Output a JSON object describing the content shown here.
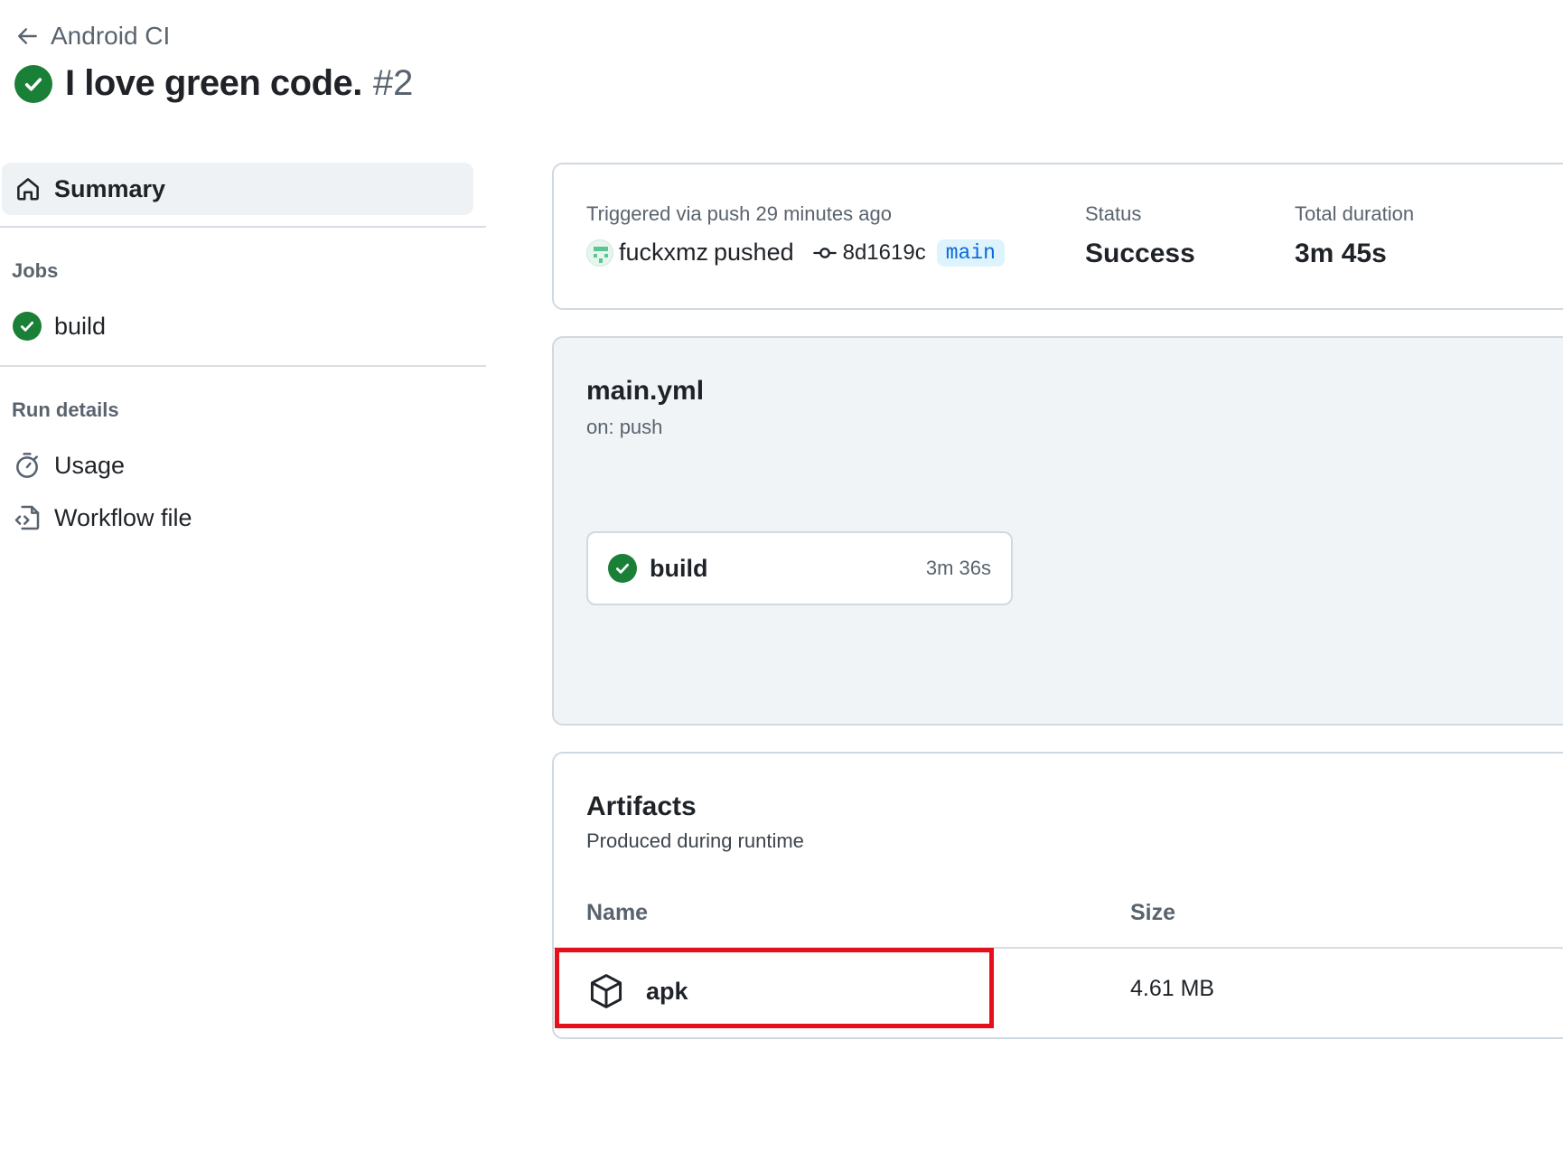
{
  "header": {
    "back_label": "Android CI",
    "run_title": "I love green code.",
    "run_number": "#2"
  },
  "sidebar": {
    "summary_label": "Summary",
    "jobs_heading": "Jobs",
    "jobs": [
      {
        "name": "build",
        "status": "success"
      }
    ],
    "run_details_heading": "Run details",
    "details": [
      {
        "label": "Usage",
        "icon": "stopwatch-icon"
      },
      {
        "label": "Workflow file",
        "icon": "file-code-icon"
      }
    ]
  },
  "summary": {
    "triggered_text": "Triggered via push 29 minutes ago",
    "actor": "fuckxmz",
    "action": "pushed",
    "commit_sha": "8d1619c",
    "branch": "main",
    "status_label": "Status",
    "status_value": "Success",
    "duration_label": "Total duration",
    "duration_value": "3m 45s"
  },
  "workflow": {
    "file_name": "main.yml",
    "trigger": "on: push",
    "job_name": "build",
    "job_duration": "3m 36s"
  },
  "artifacts": {
    "title": "Artifacts",
    "subtitle": "Produced during runtime",
    "col_name": "Name",
    "col_size": "Size",
    "rows": [
      {
        "name": "apk",
        "size": "4.61 MB"
      }
    ]
  },
  "colors": {
    "success_green": "#1a7f37",
    "branch_bg": "#ddf4ff",
    "branch_text": "#0969da",
    "highlight_red": "#e5101b"
  }
}
